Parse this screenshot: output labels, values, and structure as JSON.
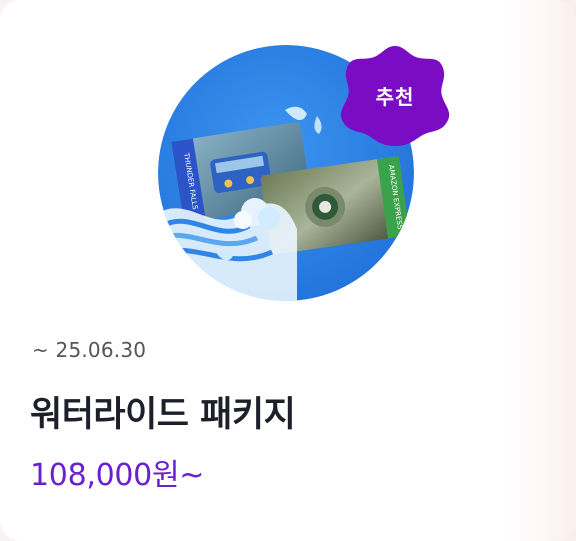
{
  "card": {
    "badge": "추천",
    "period": "~ 25.06.30",
    "title": "워터라이드 패키지",
    "price": "108,000원~",
    "image_alt": "THUNDER FALLS / AMAZON EXPRESS water ride tickets"
  },
  "colors": {
    "badge_bg": "#7a0cc4",
    "price": "#6a1fd1",
    "thumb_bg": "#2f86e6"
  }
}
